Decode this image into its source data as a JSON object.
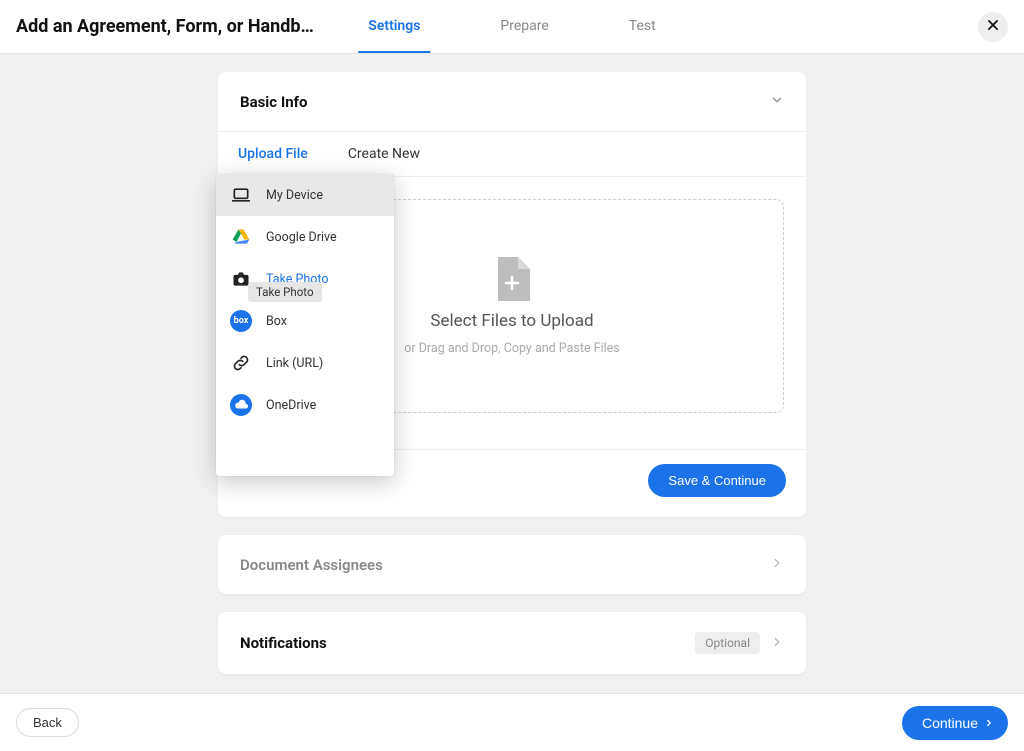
{
  "header": {
    "title": "Add an Agreement, Form, or Handb…",
    "tabs": [
      "Settings",
      "Prepare",
      "Test"
    ],
    "activeTab": 0
  },
  "card_basic": {
    "title": "Basic Info",
    "subtabs": [
      "Upload File",
      "Create New"
    ],
    "activeSubtab": 0,
    "upload": {
      "title": "Select Files to Upload",
      "subtitle": "or Drag and Drop, Copy and Paste Files"
    },
    "saveBtn": "Save & Continue"
  },
  "card_assignees": {
    "title": "Document Assignees"
  },
  "card_notifications": {
    "title": "Notifications",
    "badge": "Optional"
  },
  "footer": {
    "back": "Back",
    "continue": "Continue"
  },
  "source_menu": {
    "items": [
      {
        "label": "My Device",
        "icon": "laptop"
      },
      {
        "label": "Google Drive",
        "icon": "gdrive"
      },
      {
        "label": "Take Photo",
        "icon": "camera",
        "link": true
      },
      {
        "label": "Box",
        "icon": "box"
      },
      {
        "label": "Link (URL)",
        "icon": "link"
      },
      {
        "label": "OneDrive",
        "icon": "onedrive"
      }
    ],
    "hovered": 0,
    "tooltip": "Take Photo"
  }
}
